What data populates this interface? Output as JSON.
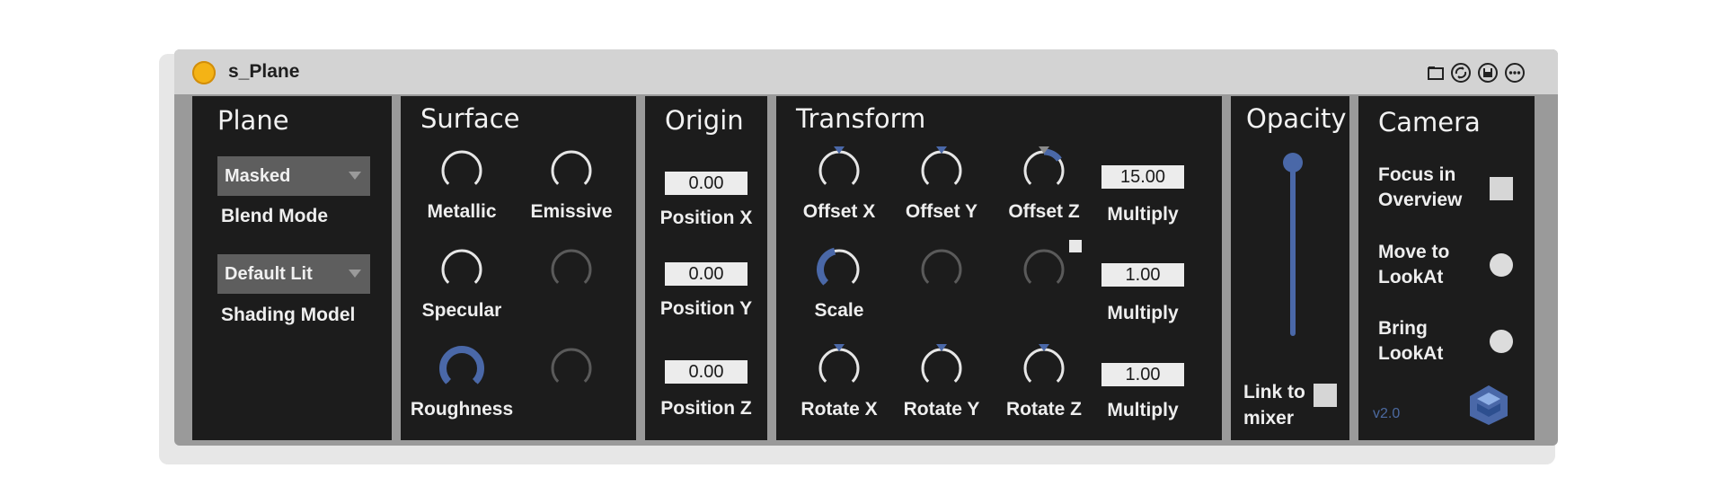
{
  "device": {
    "title": "s_Plane",
    "titlebar_icons": [
      "folder-icon",
      "hotswap-icon",
      "save-icon",
      "more-icon"
    ]
  },
  "plane": {
    "title": "Plane",
    "blend_mode": {
      "value": "Masked",
      "label": "Blend Mode"
    },
    "shading_model": {
      "value": "Default Lit",
      "label": "Shading Model"
    }
  },
  "surface": {
    "title": "Surface",
    "knobs": [
      {
        "label": "Metallic",
        "value": 0.0
      },
      {
        "label": "Emissive",
        "value": 0.0
      },
      {
        "label": "Specular",
        "value": 0.0
      },
      {
        "label": "",
        "value": 0.0,
        "disabled": true
      },
      {
        "label": "Roughness",
        "value": 1.0
      },
      {
        "label": "",
        "value": 0.0,
        "disabled": true
      }
    ]
  },
  "origin": {
    "title": "Origin",
    "fields": [
      {
        "label": "Position X",
        "value": "0.00"
      },
      {
        "label": "Position Y",
        "value": "0.00"
      },
      {
        "label": "Position Z",
        "value": "0.00"
      }
    ]
  },
  "transform": {
    "title": "Transform",
    "row1": [
      {
        "label": "Offset X",
        "value": 0.5
      },
      {
        "label": "Offset Y",
        "value": 0.5
      },
      {
        "label": "Offset Z",
        "value": 0.7
      }
    ],
    "row1_multiply": {
      "label": "Multiply",
      "value": "15.00"
    },
    "row2": [
      {
        "label": "Scale",
        "value": 0.45
      },
      {
        "label": "",
        "value": 0.0,
        "disabled": true
      },
      {
        "label": "",
        "value": 0.0,
        "disabled": true
      }
    ],
    "row2_multiply": {
      "label": "Multiply",
      "value": "1.00"
    },
    "row3": [
      {
        "label": "Rotate X",
        "value": 0.5
      },
      {
        "label": "Rotate Y",
        "value": 0.5
      },
      {
        "label": "Rotate Z",
        "value": 0.5
      }
    ],
    "row3_multiply": {
      "label": "Multiply",
      "value": "1.00"
    }
  },
  "opacity": {
    "title": "Opacity",
    "slider_value": 1.0,
    "link_label_1": "Link to",
    "link_label_2": "mixer"
  },
  "camera": {
    "title": "Camera",
    "focus_1": "Focus in",
    "focus_2": "Overview",
    "move_1": "Move to",
    "move_2": "LookAt",
    "bring_1": "Bring",
    "bring_2": "LookAt",
    "version": "v2.0"
  },
  "colors": {
    "accent": "#4a68a8",
    "panel": "#1c1c1c",
    "frame": "#9a9a9a",
    "power": "#f4b315"
  }
}
